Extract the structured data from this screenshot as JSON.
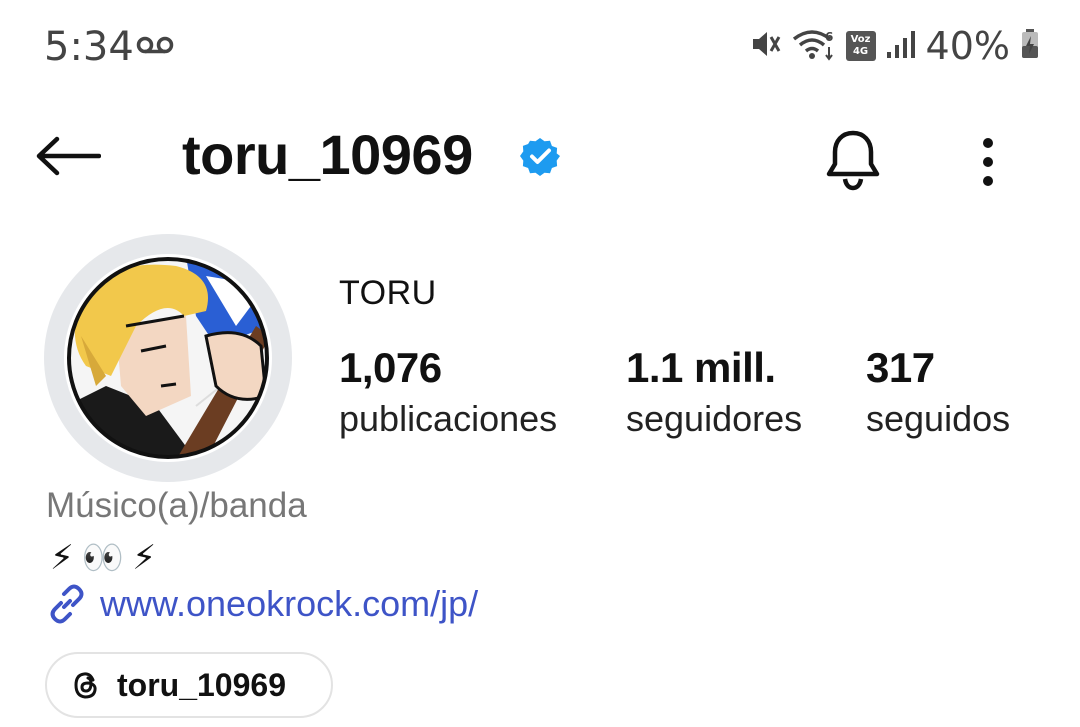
{
  "status_bar": {
    "time": "5:34",
    "battery": "40%",
    "volte_top": "Voz",
    "volte_bottom": "4G",
    "icons": [
      "voicemail-icon",
      "mute-icon",
      "wifi-icon",
      "volte-icon",
      "signal-icon",
      "battery-icon"
    ]
  },
  "header": {
    "username": "toru_10969",
    "verified": true,
    "icons": [
      "back-arrow-icon",
      "verified-badge-icon",
      "bell-icon",
      "more-vertical-icon"
    ]
  },
  "profile": {
    "display_name": "TORU",
    "stats": {
      "posts_value": "1,076",
      "posts_label": "publicaciones",
      "followers_value": "1.1 mill.",
      "followers_label": "seguidores",
      "following_value": "317",
      "following_label": "seguidos"
    },
    "category": "Músico(a)/banda",
    "bio_emojis": [
      "⚡",
      "👀",
      "⚡"
    ],
    "website": "www.oneokrock.com/jp/",
    "threads_handle": "toru_10969"
  },
  "colors": {
    "verified_blue": "#1d9bf0",
    "link_blue": "#3e54c7",
    "avatar_ring": "#e6e8eb",
    "category_gray": "#777777"
  }
}
